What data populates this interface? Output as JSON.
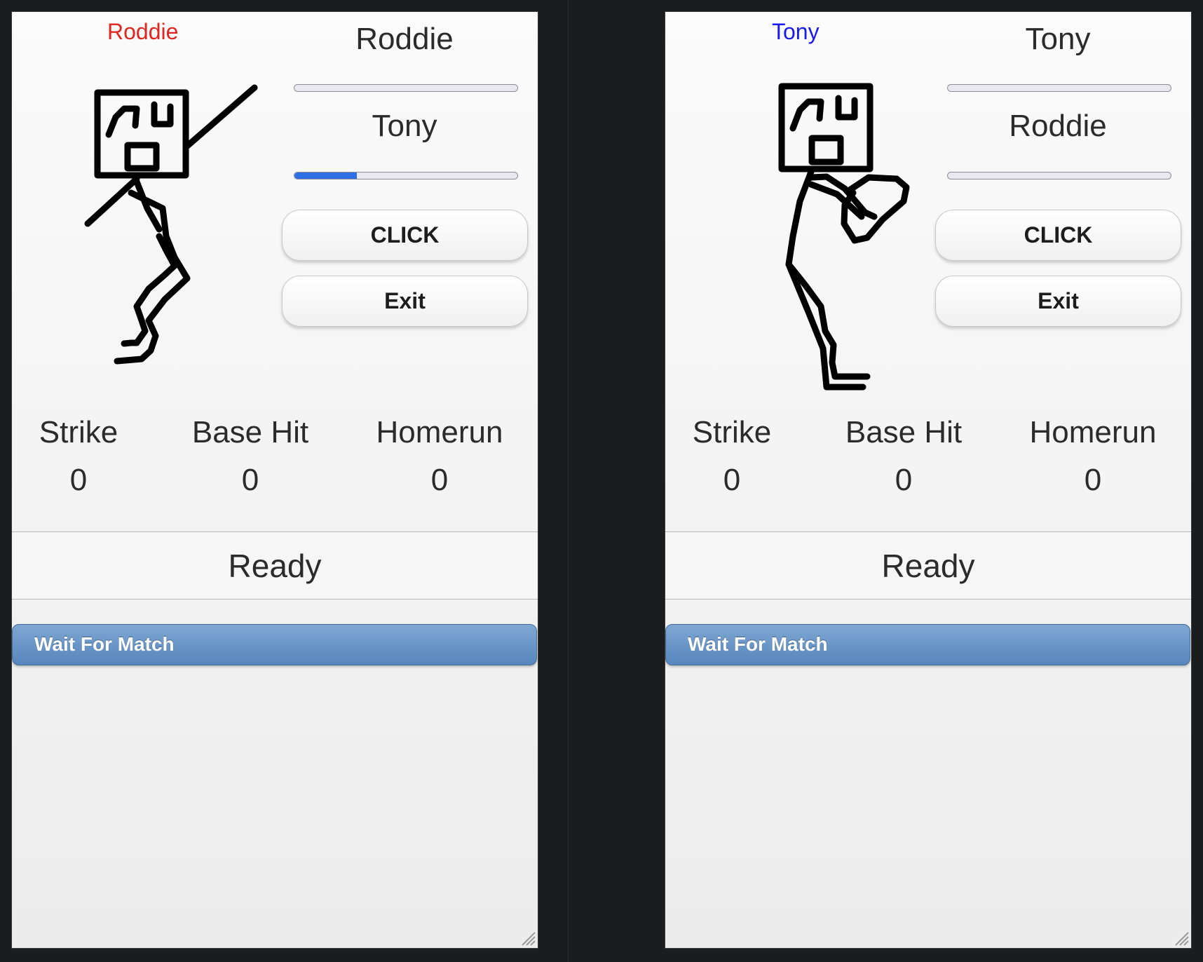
{
  "panels": [
    {
      "player_tag": "Roddie",
      "player_tag_color": "#e0261f",
      "opponent_top": "Roddie",
      "opponent_bottom": "Tony",
      "meter_top_fraction": 0,
      "meter_bottom_fraction": 0.28,
      "pose": "batter",
      "buttons": {
        "click": "CLICK",
        "exit": "Exit"
      },
      "stats": {
        "strike_label": "Strike",
        "strike_value": "0",
        "base_hit_label": "Base Hit",
        "base_hit_value": "0",
        "homerun_label": "Homerun",
        "homerun_value": "0"
      },
      "status": "Ready",
      "wait_button": "Wait For Match"
    },
    {
      "player_tag": "Tony",
      "player_tag_color": "#1a1aee",
      "opponent_top": "Tony",
      "opponent_bottom": "Roddie",
      "meter_top_fraction": 0,
      "meter_bottom_fraction": 0,
      "pose": "pitcher",
      "buttons": {
        "click": "CLICK",
        "exit": "Exit"
      },
      "stats": {
        "strike_label": "Strike",
        "strike_value": "0",
        "base_hit_label": "Base Hit",
        "base_hit_value": "0",
        "homerun_label": "Homerun",
        "homerun_value": "0"
      },
      "status": "Ready",
      "wait_button": "Wait For Match"
    }
  ],
  "icons": {
    "resize": "resize-grip-icon",
    "meter_fill_color": "#2f6fe6"
  }
}
